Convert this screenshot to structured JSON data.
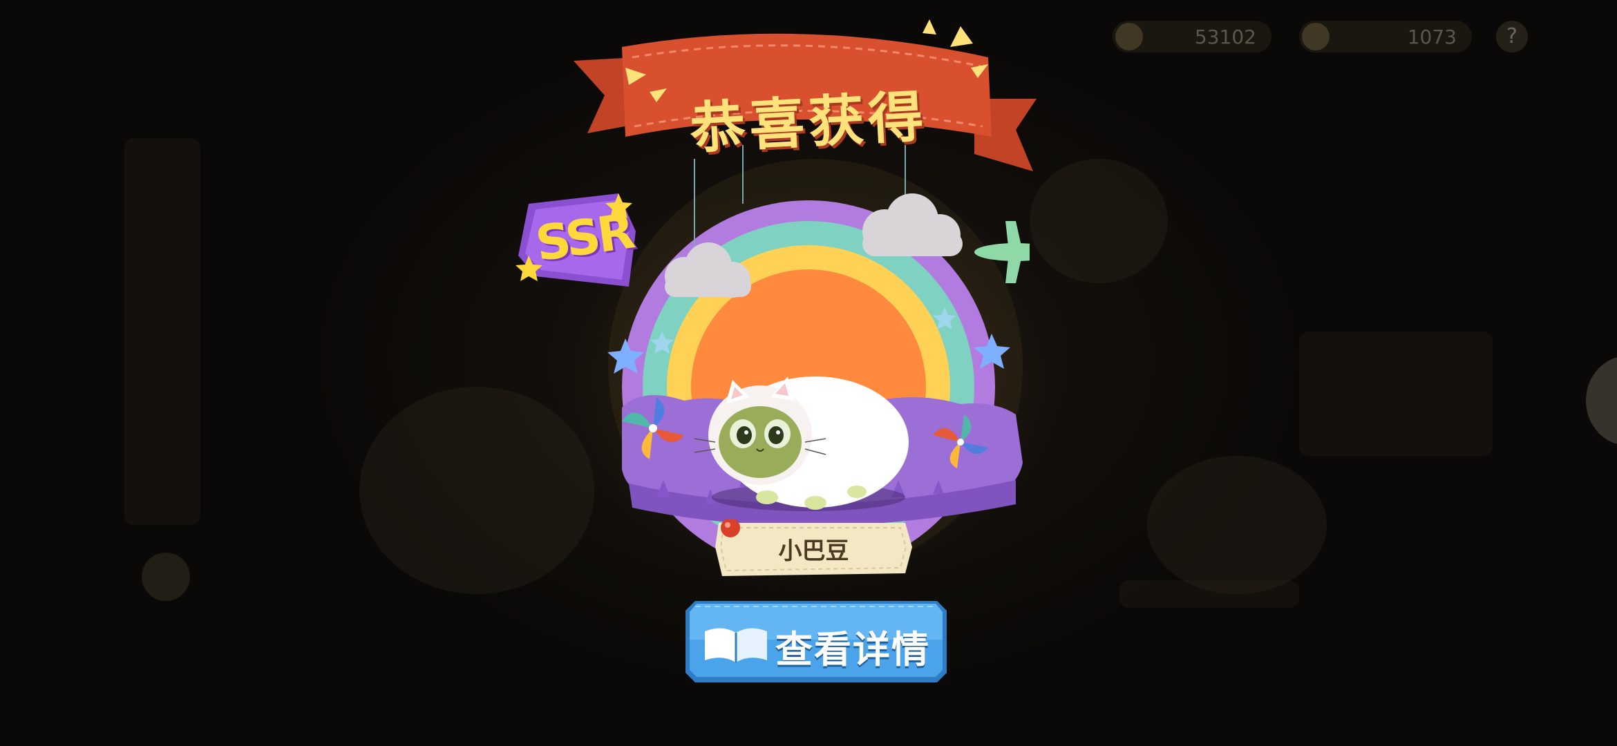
{
  "header": {
    "currency_1": "53102",
    "currency_2": "1073",
    "help_label": "?"
  },
  "reward": {
    "banner_title": "恭喜获得",
    "rarity": "SSR",
    "pet_name": "小巴豆"
  },
  "actions": {
    "view_details_label": "查看详情"
  },
  "colors": {
    "banner_red": "#d9502f",
    "title_yellow": "#ffe27a",
    "rainbow_purple": "#b27be0",
    "rainbow_teal": "#7fd1c1",
    "rainbow_yellow": "#ffd256",
    "rainbow_orange": "#ff8a3d",
    "button_blue": "#3f97e0"
  }
}
